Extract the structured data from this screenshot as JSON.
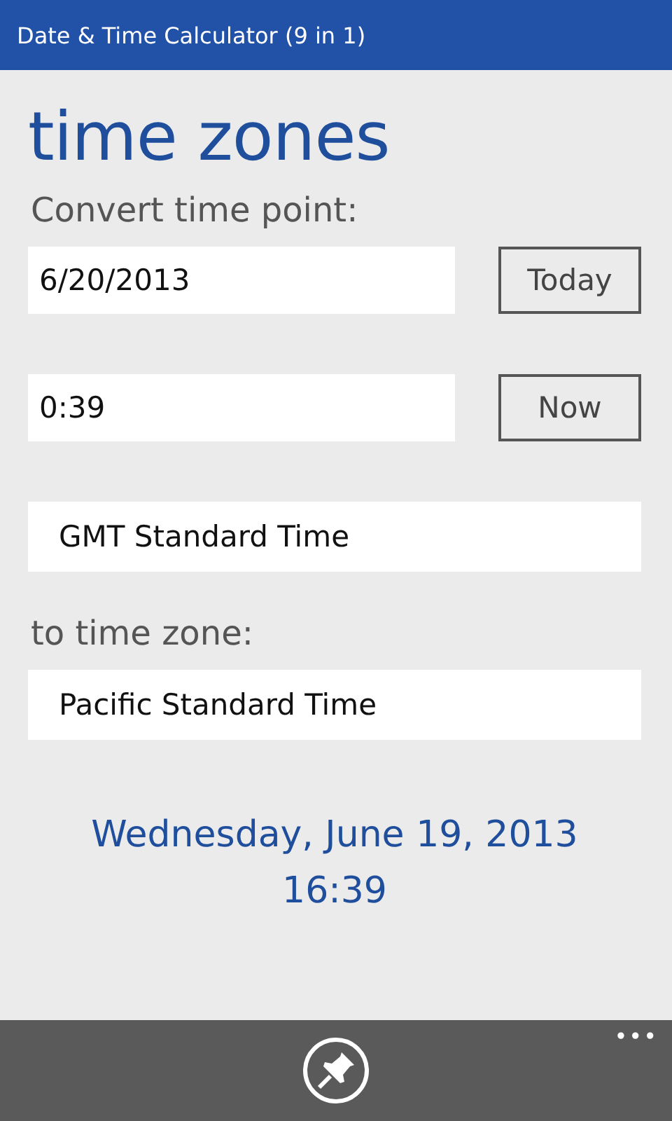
{
  "window": {
    "title": "Date & Time Calculator (9 in 1)"
  },
  "page": {
    "heading": "time zones",
    "convert_label": "Convert time point:"
  },
  "date": {
    "value": "6/20/2013",
    "button": "Today"
  },
  "time": {
    "value": "0:39",
    "button": "Now"
  },
  "from_zone": {
    "value": "GMT Standard Time"
  },
  "to_label": "to time zone:",
  "to_zone": {
    "value": "Pacific Standard Time"
  },
  "result": {
    "date": "Wednesday, June 19, 2013",
    "time": "16:39"
  },
  "app_bar": {
    "more": "•••"
  }
}
